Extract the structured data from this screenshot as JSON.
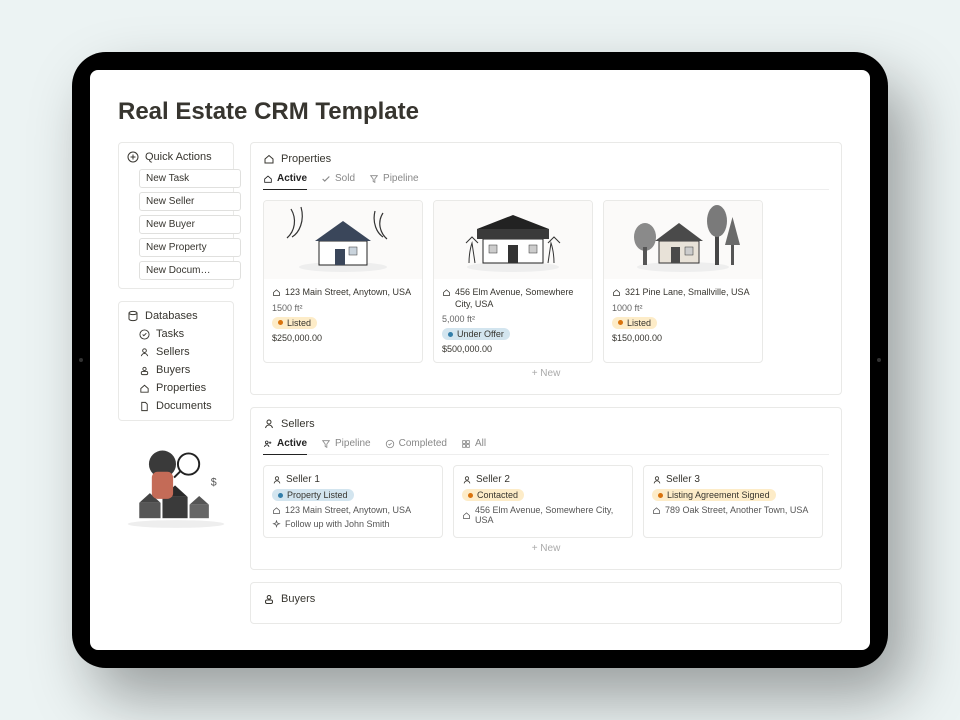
{
  "title": "Real Estate CRM Template",
  "sidebar": {
    "quick_actions": {
      "heading": "Quick Actions",
      "items": [
        "New Task",
        "New Seller",
        "New Buyer",
        "New Property",
        "New Docum…"
      ]
    },
    "databases": {
      "heading": "Databases",
      "items": [
        {
          "icon": "checklist",
          "label": "Tasks"
        },
        {
          "icon": "person",
          "label": "Sellers"
        },
        {
          "icon": "user",
          "label": "Buyers"
        },
        {
          "icon": "home",
          "label": "Properties"
        },
        {
          "icon": "doc",
          "label": "Documents"
        }
      ]
    }
  },
  "properties": {
    "heading": "Properties",
    "tabs": [
      {
        "icon": "home",
        "label": "Active",
        "active": true
      },
      {
        "icon": "check",
        "label": "Sold"
      },
      {
        "icon": "funnel",
        "label": "Pipeline"
      }
    ],
    "cards": [
      {
        "address": "123 Main Street, Anytown, USA",
        "sqft": "1500 ft²",
        "status": "Listed",
        "status_variant": "orange",
        "price": "$250,000.00",
        "thumb": "house1"
      },
      {
        "address": "456 Elm Avenue, Somewhere City, USA",
        "sqft": "5,000 ft²",
        "status": "Under Offer",
        "status_variant": "blue",
        "price": "$500,000.00",
        "thumb": "house2"
      },
      {
        "address": "321 Pine Lane, Smallville, USA",
        "sqft": "1000 ft²",
        "status": "Listed",
        "status_variant": "orange",
        "price": "$150,000.00",
        "thumb": "cabin"
      }
    ],
    "new_label": "+  New"
  },
  "sellers": {
    "heading": "Sellers",
    "tabs": [
      {
        "icon": "person2",
        "label": "Active",
        "active": true
      },
      {
        "icon": "funnel",
        "label": "Pipeline"
      },
      {
        "icon": "done",
        "label": "Completed"
      },
      {
        "icon": "grid",
        "label": "All"
      }
    ],
    "cards": [
      {
        "name": "Seller 1",
        "status": "Property Listed",
        "status_variant": "blue",
        "address": "123 Main Street, Anytown, USA",
        "note": "Follow up with John Smith"
      },
      {
        "name": "Seller 2",
        "status": "Contacted",
        "status_variant": "orange",
        "address": "456 Elm Avenue, Somewhere City, USA"
      },
      {
        "name": "Seller 3",
        "status": "Listing Agreement Signed",
        "status_variant": "orange",
        "address": "789 Oak Street, Another Town, USA"
      }
    ],
    "new_label": "+  New"
  },
  "buyers": {
    "heading": "Buyers"
  }
}
